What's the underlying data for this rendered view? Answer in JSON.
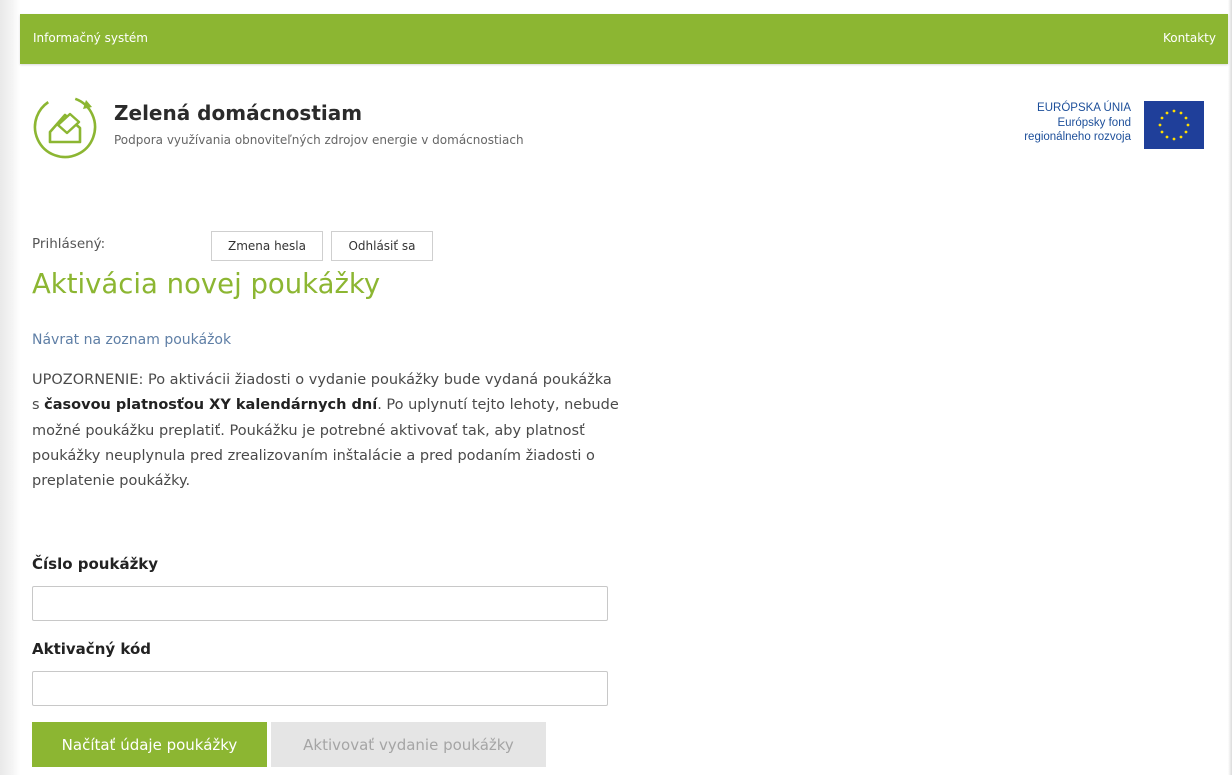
{
  "topbar": {
    "left_label": "Informačný systém",
    "right_label": "Kontakty",
    "color": "#8cb632"
  },
  "brand": {
    "title": "Zelená domácnostiam",
    "subtitle": "Podpora využívania obnoviteľných zdrojov energie v domácnostiach"
  },
  "eu": {
    "line1": "EURÓPSKA ÚNIA",
    "line2": "Európsky fond",
    "line3": "regionálneho rozvoja",
    "flag_color": "#1f3f9a",
    "star_color": "#ffdd00"
  },
  "session": {
    "logged_label": "Prihlásený:",
    "change_password_label": "Zmena hesla",
    "logout_label": "Odhlásiť sa"
  },
  "page": {
    "title": "Aktivácia novej poukážky",
    "back_link": "Návrat na zoznam poukážok",
    "warning": {
      "prefix": "UPOZORNENIE: Po aktivácii žiadosti o vydanie poukážky bude vydaná poukážka s ",
      "bold": "časovou platnosťou XY kalendárnych dní",
      "suffix": ". Po uplynutí tejto lehoty, nebude možné poukážku preplatiť. Poukážku je potrebné aktivovať tak, aby platnosť poukážky neuplynula pred zrealizovaním inštalácie a pred podaním žiadosti o preplatenie poukážky."
    }
  },
  "form": {
    "voucher_number_label": "Číslo poukážky",
    "voucher_number_value": "",
    "activation_code_label": "Aktivačný kód",
    "activation_code_value": "",
    "load_button": "Načítať údaje poukážky",
    "activate_button": "Aktivovať vydanie poukážky"
  }
}
